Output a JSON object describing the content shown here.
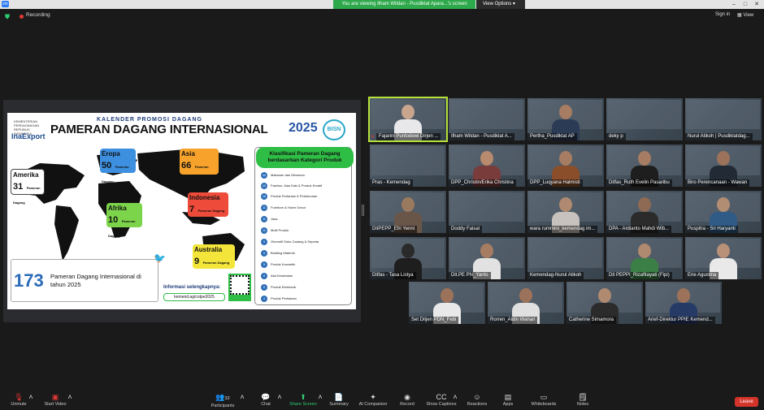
{
  "window": {
    "banner": "You are viewing Ilham Wildan - Pusdiklat Apara...'s screen",
    "view_options": "View Options",
    "controls": [
      "–",
      "□",
      "✕"
    ]
  },
  "topbar": {
    "recording": "Recording",
    "sign_in": "Sign in",
    "view": "View"
  },
  "slide": {
    "kementerian": "KEMENTERIAN PERDAGANGAN REPUBLIK INDONESIA",
    "inaexport": "InaExport",
    "kalender": "KALENDER PROMOSI DAGANG",
    "pameran": "PAMERAN DAGANG INTERNASIONAL",
    "year": "2025",
    "bsn": "BISN",
    "regions": [
      {
        "name": "Amerika",
        "count": "31",
        "label": "Pameran Dagang",
        "color": "#ffffff"
      },
      {
        "name": "Eropa",
        "count": "50",
        "label": "Pameran Dagang",
        "color": "#3d8fe0"
      },
      {
        "name": "Asia",
        "count": "66",
        "label": "Pameran Dagang",
        "color": "#f6a22b"
      },
      {
        "name": "Afrika",
        "count": "10",
        "label": "Pameran Dagang",
        "color": "#7cd44a"
      },
      {
        "name": "Indonesia",
        "count": "7",
        "label": "Pameran Dagang",
        "color": "#ef4b3a"
      },
      {
        "name": "Australia",
        "count": "9",
        "label": "Pameran Dagang",
        "color": "#f3e53a"
      }
    ],
    "klasifikasi_title": "Klasifikasi Pameran Dagang berdasarkan Kategori Produk",
    "klasifikasi": [
      {
        "num": "44",
        "label": "Makanan dan Minuman"
      },
      {
        "num": "40",
        "label": "Fashion, Alas Kaki & Produk Kreatif"
      },
      {
        "num": "16",
        "label": "Produk Pertanian & Perkebunan"
      },
      {
        "num": "11",
        "label": "Furniture & Home Decor"
      },
      {
        "num": "11",
        "label": "Jasa"
      },
      {
        "num": "11",
        "label": "Multi Produk"
      },
      {
        "num": "9",
        "label": "Otomotif Suku Cadang & Sepeda"
      },
      {
        "num": "9",
        "label": "Building Material"
      },
      {
        "num": "5",
        "label": "Produk Kosmetik"
      },
      {
        "num": "5",
        "label": "Alat Kesehatan"
      },
      {
        "num": "5",
        "label": "Produk Elektronik"
      },
      {
        "num": "4",
        "label": "Produk Perikanan"
      }
    ],
    "stat_number": "173",
    "stat_text": "Pameran Dagang Internasional di tahun 2025",
    "info": "Informasi selengkapnya:",
    "link": "kemend.ag/cotpe2025"
  },
  "participants": [
    {
      "name": "Fajarini Puntodewi Dirjen ...",
      "muted": true,
      "active": true,
      "skin": "#c9a58e",
      "shirt": "#e8e8ea"
    },
    {
      "name": "Ilham Wildan - Pusdiklat A...",
      "muted": false,
      "active": false,
      "skin": "",
      "shirt": ""
    },
    {
      "name": "Pertha_Pusdiklat AP",
      "muted": false,
      "active": false,
      "skin": "#a67c62",
      "shirt": "#2b3a55"
    },
    {
      "name": "deky p",
      "muted": false,
      "active": false,
      "skin": "",
      "shirt": ""
    },
    {
      "name": "Nurul Atikoh | Pusdiklatdag...",
      "muted": false,
      "active": false,
      "skin": "",
      "shirt": ""
    },
    {
      "name": "Pras - Kemendag",
      "muted": false,
      "active": false,
      "skin": "",
      "shirt": ""
    },
    {
      "name": "DPP_Christin/Erika Christina",
      "muted": false,
      "active": false,
      "skin": "#b88a6e",
      "shirt": "#7a3b3b"
    },
    {
      "name": "DPP_Luqyana Halmisti",
      "muted": false,
      "active": false,
      "skin": "#a67c62",
      "shirt": "#8a4f2a"
    },
    {
      "name": "Ditfas_Ruth Evelin Pasaribu",
      "muted": false,
      "active": false,
      "skin": "#a67c62",
      "shirt": "#1e1e1e"
    },
    {
      "name": "Biro Perencanaan - Wawan",
      "muted": false,
      "active": false,
      "skin": "#9c735a",
      "shirt": "#222a35"
    },
    {
      "name": "DitPEPP_Efri Yenni",
      "muted": false,
      "active": false,
      "skin": "#9a7a5e",
      "shirt": "#6a5648"
    },
    {
      "name": "Doddy Faisal",
      "muted": false,
      "active": false,
      "skin": "",
      "shirt": ""
    },
    {
      "name": "wara rummini_kemendag im...",
      "muted": false,
      "active": false,
      "skin": "#b08a70",
      "shirt": "#c7c2bd"
    },
    {
      "name": "DPA - Ardianto Mahdi Wib...",
      "muted": false,
      "active": false,
      "skin": "#8e6a54",
      "shirt": "#2b2b2b"
    },
    {
      "name": "Puspitra - Sri Haryanti",
      "muted": false,
      "active": false,
      "skin": "#b18d74",
      "shirt": "#2f5b86"
    },
    {
      "name": "Ditfas - Tasa Listya",
      "muted": false,
      "active": false,
      "skin": "#2a2a2a",
      "shirt": "#1e1e1e"
    },
    {
      "name": "Dit.PE PN_Yanto",
      "muted": false,
      "active": false,
      "skin": "#a67c62",
      "shirt": "#e2e2e2"
    },
    {
      "name": "Kemendag-Nurul Atikoh",
      "muted": false,
      "active": false,
      "skin": "",
      "shirt": ""
    },
    {
      "name": "Dit PEPPI_Rizafitayati (Fipi)",
      "muted": false,
      "active": false,
      "skin": "#b08a70",
      "shirt": "#3b7f46"
    },
    {
      "name": "Erie Agustina",
      "muted": false,
      "active": false,
      "skin": "#b99078",
      "shirt": "#e9e9e9"
    },
    {
      "name": "Set Ditjen PDN_Febi",
      "muted": false,
      "active": false,
      "skin": "#9c735a",
      "shirt": "#e8e8e8"
    },
    {
      "name": "Rorren_Aldin Wahari",
      "muted": false,
      "active": false,
      "skin": "#9c735a",
      "shirt": "#e0e0e0"
    },
    {
      "name": "Catherine Simamora",
      "muted": false,
      "active": false,
      "skin": "#b08a70",
      "shirt": "#2b2b2b"
    },
    {
      "name": "Arief-Direktur PPIE Kemend...",
      "muted": false,
      "active": false,
      "skin": "#9c735a",
      "shirt": "#263a66"
    }
  ],
  "toolbar": {
    "unmute": "Unmute",
    "start_video": "Start Video",
    "participants": "Participants",
    "participants_count": "32",
    "chat": "Chat",
    "share_screen": "Share Screen",
    "summary": "Summary",
    "ai_companion": "AI Companion",
    "record": "Record",
    "show_captions": "Show Captions",
    "reactions": "Reactions",
    "apps": "Apps",
    "whiteboards": "Whiteboards",
    "notes": "Notes",
    "leave": "Leave"
  }
}
